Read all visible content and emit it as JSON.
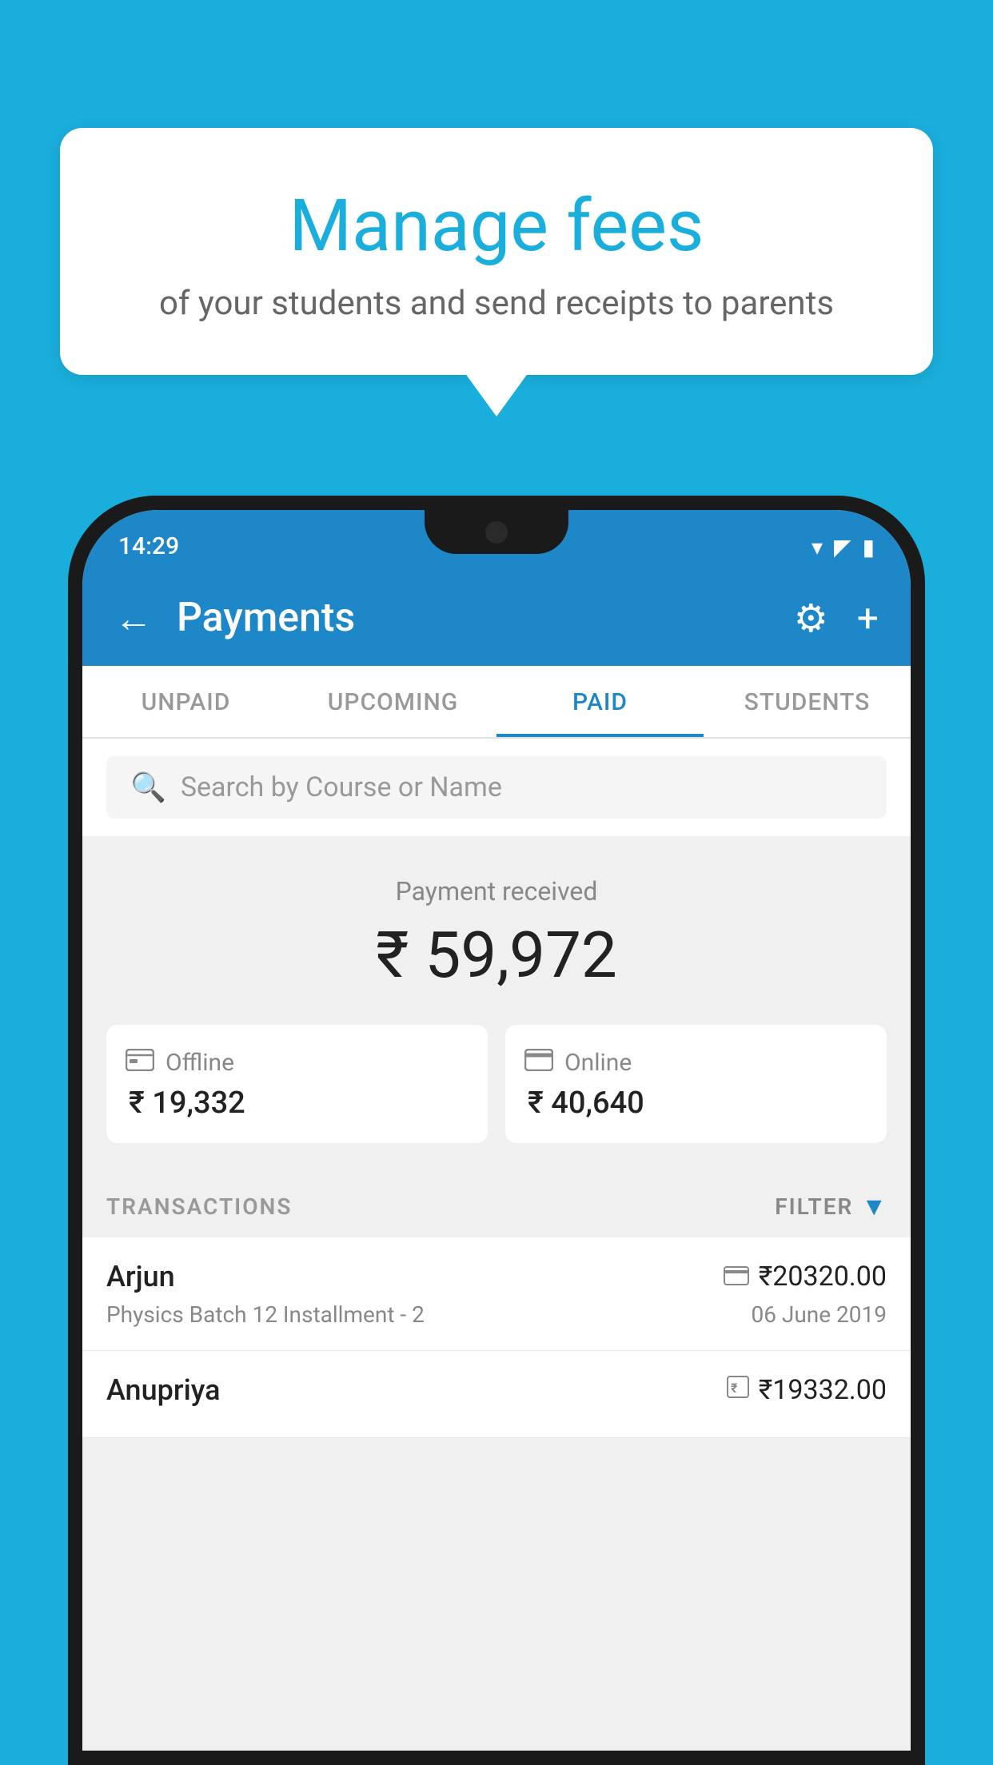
{
  "background_color": "#1AAEDC",
  "bubble": {
    "title": "Manage fees",
    "subtitle": "of your students and send receipts to parents"
  },
  "status_bar": {
    "time": "14:29",
    "wifi": "▾",
    "signal": "▲",
    "battery": "▮"
  },
  "app_bar": {
    "title": "Payments",
    "back_label": "←",
    "plus_label": "+",
    "gear_label": "⚙"
  },
  "tabs": [
    {
      "label": "UNPAID",
      "active": false
    },
    {
      "label": "UPCOMING",
      "active": false
    },
    {
      "label": "PAID",
      "active": true
    },
    {
      "label": "STUDENTS",
      "active": false
    }
  ],
  "search": {
    "placeholder": "Search by Course or Name"
  },
  "payment_summary": {
    "label": "Payment received",
    "total": "₹ 59,972",
    "offline": {
      "type": "Offline",
      "amount": "₹ 19,332",
      "icon": "offline"
    },
    "online": {
      "type": "Online",
      "amount": "₹ 40,640",
      "icon": "online"
    }
  },
  "transactions": {
    "label": "TRANSACTIONS",
    "filter_label": "FILTER",
    "items": [
      {
        "name": "Arjun",
        "amount": "₹20320.00",
        "detail": "Physics Batch 12 Installment - 2",
        "date": "06 June 2019",
        "payment_type": "card"
      },
      {
        "name": "Anupriya",
        "amount": "₹19332.00",
        "detail": "",
        "date": "",
        "payment_type": "cash"
      }
    ]
  }
}
